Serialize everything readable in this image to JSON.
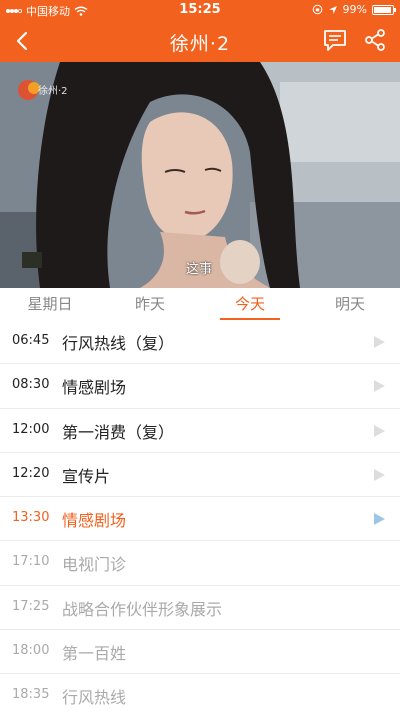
{
  "status": {
    "carrier": "中国移动",
    "time": "15:25",
    "battery": "99%"
  },
  "nav": {
    "title": "徐州·2",
    "icons": [
      "back-icon",
      "comment-icon",
      "share-icon"
    ]
  },
  "video": {
    "channel_logo": "徐州·2",
    "subtitle": "这事"
  },
  "day_tabs": {
    "items": [
      "星期日",
      "昨天",
      "今天",
      "明天"
    ],
    "active": "今天"
  },
  "schedule": [
    {
      "time": "06:45",
      "title": "行风热线（复）",
      "state": "past"
    },
    {
      "time": "08:30",
      "title": "情感剧场",
      "state": "past"
    },
    {
      "time": "12:00",
      "title": "第一消费（复）",
      "state": "past"
    },
    {
      "time": "12:20",
      "title": "宣传片",
      "state": "past"
    },
    {
      "time": "13:30",
      "title": "情感剧场",
      "state": "current"
    },
    {
      "time": "17:10",
      "title": "电视门诊",
      "state": "future"
    },
    {
      "time": "17:25",
      "title": "战略合作伙伴形象展示",
      "state": "future"
    },
    {
      "time": "18:00",
      "title": "第一百姓",
      "state": "future"
    },
    {
      "time": "18:35",
      "title": "行风热线",
      "state": "future"
    }
  ],
  "colors": {
    "accent": "#f2611d",
    "current_play": "#9dc6e6",
    "past_play": "#dddddd"
  }
}
